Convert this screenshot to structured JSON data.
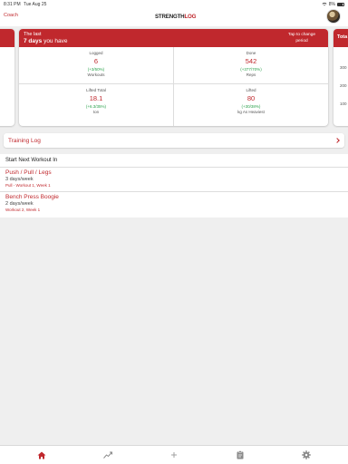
{
  "status_bar": {
    "time": "8:31 PM",
    "date": "Tue Aug 25",
    "battery": "8%"
  },
  "nav": {
    "coach_label": "Coach",
    "logo_left": "STRENGTH",
    "logo_right": "LOG",
    "avatar_icon": "user-avatar"
  },
  "stats_card": {
    "header_line1": "The last",
    "period_value": "7 days",
    "period_suffix": "you have",
    "tap_hint": "Tap to change period",
    "cells": [
      {
        "label": "Logged",
        "value": "6",
        "change": "(+3/50%)",
        "unit": "Workouts"
      },
      {
        "label": "Done",
        "value": "542",
        "change": "(+377/70%)",
        "unit": "Reps"
      },
      {
        "label": "Lifted Total",
        "value": "18.1",
        "change": "(+6.3/35%)",
        "unit": "ton"
      },
      {
        "label": "Lifted",
        "value": "80",
        "change": "(+30/38%)",
        "unit": "kg As Heaviest"
      }
    ]
  },
  "right_card": {
    "title": "Tota",
    "ticks": [
      "300",
      "200",
      "100"
    ]
  },
  "training_log": {
    "label": "Training Log"
  },
  "start_next": {
    "title": "Start Next Workout In",
    "workouts": [
      {
        "name": "Push / Pull / Legs",
        "frequency": "3 days/week",
        "next": "Pull - Workout 1, Week 1"
      },
      {
        "name": "Bench Press Boogie",
        "frequency": "2 days/week",
        "next": "Workout 2, Week 1"
      }
    ]
  },
  "tabs": [
    {
      "icon": "home-icon",
      "active": true
    },
    {
      "icon": "chart-icon",
      "active": false
    },
    {
      "icon": "plus-icon",
      "active": false
    },
    {
      "icon": "clipboard-icon",
      "active": false
    },
    {
      "icon": "gear-icon",
      "active": false
    }
  ],
  "colors": {
    "accent": "#c0282d",
    "positive": "#2ba24c",
    "background": "#efefef"
  }
}
